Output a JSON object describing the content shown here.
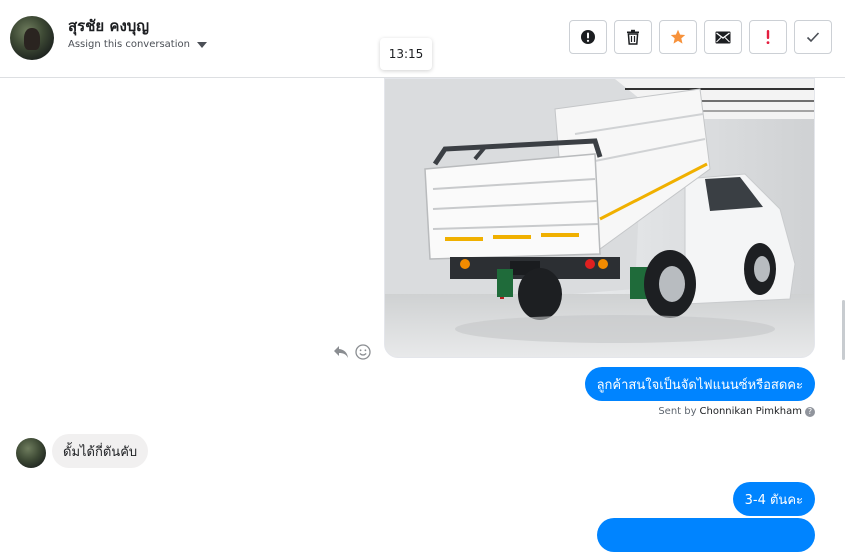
{
  "header": {
    "contact_name": "สุรชัย คงบุญ",
    "assign_label": "Assign this conversation",
    "actions": [
      {
        "name": "mark-spam-button",
        "icon": "exclamation-circle-icon"
      },
      {
        "name": "delete-button",
        "icon": "trash-icon"
      },
      {
        "name": "star-button",
        "icon": "star-icon"
      },
      {
        "name": "mark-unread-button",
        "icon": "envelope-icon"
      },
      {
        "name": "follow-up-button",
        "icon": "exclamation-icon"
      },
      {
        "name": "mark-done-button",
        "icon": "checkmark-icon"
      }
    ]
  },
  "timestamp_tooltip": "13:15",
  "messages": {
    "outgoing_1": "ลูกค้าสนใจเป็นจัดไฟแนนซ์หรือสดคะ",
    "sent_by_prefix": "Sent by",
    "sent_by_name": "Chonnikan Pimkham",
    "incoming_1": "ดั้มได้กี่ตันคับ",
    "outgoing_2": "3-4 ตันคะ"
  },
  "colors": {
    "accent": "#0084ff",
    "star": "#f7923b",
    "alert": "#e41e3f"
  }
}
